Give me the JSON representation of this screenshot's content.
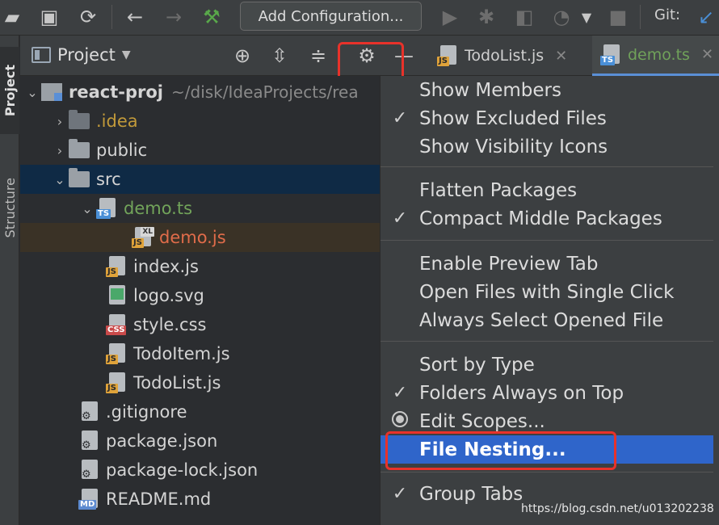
{
  "toolbar": {
    "add_configuration": "Add Configuration...",
    "git_label": "Git:"
  },
  "left_strip": {
    "project_tab": "Project",
    "structure_tab": "Structure"
  },
  "project_panel": {
    "title": "Project"
  },
  "editor_tabs": [
    {
      "label": "TodoList.js",
      "badge": "JS"
    },
    {
      "label": "demo.ts",
      "badge": "TS"
    }
  ],
  "tree": {
    "root_name": "react-proj",
    "root_path": "~/disk/IdeaProjects/rea",
    "items": {
      "idea": ".idea",
      "public": "public",
      "src": "src",
      "demo_ts": "demo.ts",
      "demo_js": "demo.js",
      "index_js": "index.js",
      "logo_svg": "logo.svg",
      "style_css": "style.css",
      "todoitem_js": "TodoItem.js",
      "todolist_js": "TodoList.js",
      "gitignore": ".gitignore",
      "package_json": "package.json",
      "package_lock_json": "package-lock.json",
      "readme_md": "README.md"
    },
    "badges": {
      "js": "JS",
      "ts": "TS",
      "css": "CSS",
      "md": "MD",
      "xl": "XL"
    }
  },
  "menu": {
    "items": [
      {
        "label": "Show Members",
        "checked": false
      },
      {
        "label": "Show Excluded Files",
        "checked": true
      },
      {
        "label": "Show Visibility Icons",
        "checked": false
      },
      {
        "label": "Flatten Packages",
        "checked": false
      },
      {
        "label": "Compact Middle Packages",
        "checked": true
      },
      {
        "label": "Enable Preview Tab",
        "checked": false
      },
      {
        "label": "Open Files with Single Click",
        "checked": false
      },
      {
        "label": "Always Select Opened File",
        "checked": false
      },
      {
        "label": "Sort by Type",
        "checked": false
      },
      {
        "label": "Folders Always on Top",
        "checked": true
      },
      {
        "label": "Edit Scopes...",
        "checked": false
      },
      {
        "label": "File Nesting...",
        "checked": false
      },
      {
        "label": "Group Tabs",
        "checked": true
      }
    ],
    "check_glyph": "✓"
  },
  "watermark": "https://blog.csdn.net/u013202238",
  "colors": {
    "highlight_box": "#e8322a",
    "selection": "#2f65ca"
  }
}
